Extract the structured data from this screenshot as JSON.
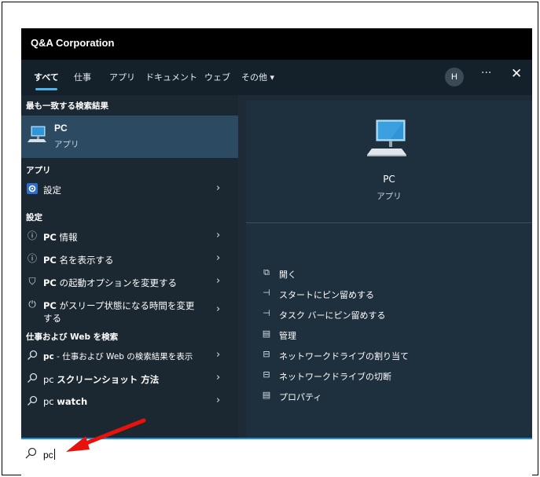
{
  "window": {
    "org_name": "Q&A Corporation"
  },
  "tabs": [
    {
      "label": "すべて",
      "active": true
    },
    {
      "label": "仕事",
      "active": false
    },
    {
      "label": "アプリ",
      "active": false
    },
    {
      "label": "ドキュメント",
      "active": false
    },
    {
      "label": "ウェブ",
      "active": false
    },
    {
      "label": "その他 ▾",
      "active": false
    }
  ],
  "header": {
    "avatar_initial": "H",
    "more_label": "···",
    "close_label": "✕"
  },
  "left": {
    "best_match_header": "最も一致する検索結果",
    "best_match": {
      "title": "PC",
      "subtitle": "アプリ",
      "icon": "pc-monitor-icon"
    },
    "apps_header": "アプリ",
    "apps": [
      {
        "label": "設定",
        "icon": "settings-gear-icon"
      }
    ],
    "settings_header": "設定",
    "settings": [
      {
        "label_bold": "PC",
        "label_rest": " 情報",
        "icon": "info-icon"
      },
      {
        "label_bold": "PC",
        "label_rest": " 名を表示する",
        "icon": "info-icon"
      },
      {
        "label_bold": "PC",
        "label_rest": " の起動オプションを変更する",
        "icon": "recovery-icon"
      },
      {
        "label_bold": "PC",
        "label_rest": " がスリープ状態になる時間を変更",
        "label_line2": "する",
        "icon": "power-icon"
      }
    ],
    "web_header": "仕事および Web を検索",
    "web": [
      {
        "label_bold": "pc",
        "label_rest": " - 仕事および Web の検索結果を表示"
      },
      {
        "label_plain": "pc ",
        "label_bold": "スクリーンショット 方法"
      },
      {
        "label_plain": "pc ",
        "label_bold": "watch"
      }
    ]
  },
  "right": {
    "title": "PC",
    "subtitle": "アプリ",
    "actions": [
      {
        "label": "開く",
        "icon": "open-icon"
      },
      {
        "label": "スタートにピン留めする",
        "icon": "pin-icon"
      },
      {
        "label": "タスク バーにピン留めする",
        "icon": "pin-icon"
      },
      {
        "label": "管理",
        "icon": "manage-icon"
      },
      {
        "label": "ネットワークドライブの割り当て",
        "icon": "network-drive-icon"
      },
      {
        "label": "ネットワークドライブの切断",
        "icon": "network-drive-icon"
      },
      {
        "label": "プロパティ",
        "icon": "properties-icon"
      }
    ]
  },
  "search": {
    "value": "pc"
  },
  "colors": {
    "accent": "#1d8fd6",
    "highlight": "#2c4a62",
    "annotation_arrow": "#e8120c"
  }
}
